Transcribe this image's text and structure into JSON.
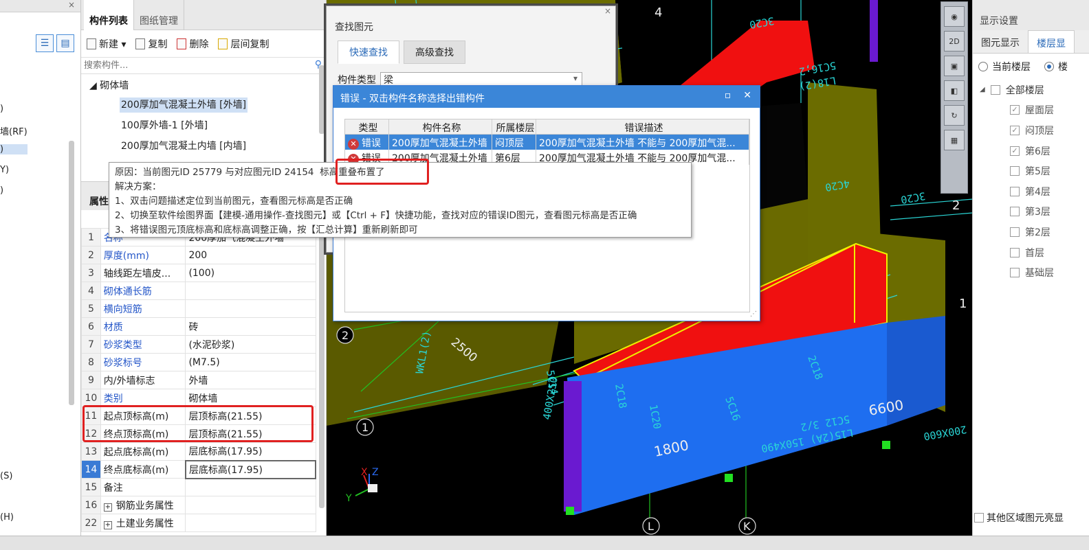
{
  "left_panel": {
    "items": [
      ")",
      "墙(RF)",
      ")",
      "Y)",
      ")",
      "(S)",
      "(H)"
    ]
  },
  "component_panel": {
    "tabs": [
      {
        "label": "构件列表",
        "active": true
      },
      {
        "label": "图纸管理",
        "active": false
      }
    ],
    "toolbar": {
      "new": "新建 ▾",
      "copy": "复制",
      "delete": "删除",
      "floor_copy": "层间复制"
    },
    "search_placeholder": "搜索构件...",
    "tree": {
      "root": "◢ 砌体墙",
      "items": [
        "200厚加气混凝土外墙 [外墙]",
        "100厚外墙-1 [外墙]",
        "200厚加气混凝土内墙 [内墙]"
      ]
    },
    "attr_title": "属性",
    "attributes": [
      {
        "n": "1",
        "key": "名称",
        "value": "200厚加气混凝土外墙",
        "blue": true
      },
      {
        "n": "2",
        "key": "厚度(mm)",
        "value": "200",
        "blue": true
      },
      {
        "n": "3",
        "key": "轴线距左墙皮...",
        "value": "(100)",
        "blue": false
      },
      {
        "n": "4",
        "key": "砌体通长筋",
        "value": "",
        "blue": true
      },
      {
        "n": "5",
        "key": "横向短筋",
        "value": "",
        "blue": true
      },
      {
        "n": "6",
        "key": "材质",
        "value": "砖",
        "blue": true
      },
      {
        "n": "7",
        "key": "砂浆类型",
        "value": "(水泥砂浆)",
        "blue": true
      },
      {
        "n": "8",
        "key": "砂浆标号",
        "value": "(M7.5)",
        "blue": true
      },
      {
        "n": "9",
        "key": "内/外墙标志",
        "value": "外墙",
        "blue": false
      },
      {
        "n": "10",
        "key": "类别",
        "value": "砌体墙",
        "blue": true
      },
      {
        "n": "11",
        "key": "起点顶标高(m)",
        "value": "层顶标高(21.55)",
        "blue": false
      },
      {
        "n": "12",
        "key": "终点顶标高(m)",
        "value": "层顶标高(21.55)",
        "blue": false
      },
      {
        "n": "13",
        "key": "起点底标高(m)",
        "value": "层底标高(17.95)",
        "blue": false
      },
      {
        "n": "14",
        "key": "终点底标高(m)",
        "value": "层底标高(17.95)",
        "blue": false
      },
      {
        "n": "15",
        "key": "备注",
        "value": "",
        "blue": false
      },
      {
        "n": "16",
        "key": "钢筋业务属性",
        "value": "",
        "blue": false
      },
      {
        "n": "22",
        "key": "土建业务属性",
        "value": "",
        "blue": false
      }
    ]
  },
  "find_dialog": {
    "title": "查找图元",
    "close": "×",
    "tabs": [
      {
        "label": "快速查找",
        "active": true
      },
      {
        "label": "高级查找",
        "active": false
      }
    ],
    "type_label": "构件类型",
    "type_value": "梁"
  },
  "error_dialog": {
    "title": "错误 - 双击构件名称选择出错构件",
    "headers": [
      "类型",
      "构件名称",
      "所属楼层",
      "错误描述"
    ],
    "rows": [
      {
        "type": "错误",
        "name": "200厚加气混凝土外墙",
        "floor": "闷顶层",
        "desc": "200厚加气混凝土外墙 不能与 200厚加气混...",
        "selected": true
      },
      {
        "type": "错误",
        "name": "200厚加气混凝土外墙",
        "floor": "第6层",
        "desc": "200厚加气混凝土外墙 不能与 200厚加气混...",
        "selected": false
      }
    ]
  },
  "tooltip": {
    "reason_prefix": "原因：当前图元ID 25779 与对应图元ID 24154",
    "reason_highlight": "标高重叠布置了",
    "solution_title": "解决方案：",
    "steps": [
      "1、双击问题描述定位到当前图元，查看图元标高是否正确",
      "2、切换至软件绘图界面【建模-通用操作-查找图元】或【Ctrl + F】快捷功能，查找对应的错误ID图元，查看图元标高是否正确",
      "3、将错误图元顶底标高和底标高调整正确，按【汇总计算】重新刷新即可"
    ]
  },
  "viewport": {
    "labels": {
      "axis_4": "4",
      "axis_2_right": "2",
      "axis_1_right": "1",
      "axis_2_left": "2",
      "axis_1_left": "1",
      "axis_L": "L",
      "axis_K": "K",
      "dim_1800": "1800",
      "dim_6600": "6600",
      "dim_2500": "2500",
      "axis_x": "X",
      "axis_y": "Y",
      "axis_z": "Z",
      "beam_text_1": "3C20",
      "beam_text_2": "5C16;2",
      "beam_text_3": "L18(2)",
      "beam_text_4": "4C20",
      "beam_text_5": "3C20",
      "beam_text_6": "5C16",
      "beam_text_7": "2C18",
      "beam_text_8": "5C12 3/2",
      "beam_text_9": "L15(2A) 150X490",
      "beam_text_10": "200X600",
      "beam_text_11": "5C14",
      "beam_text_12": "2C18",
      "beam_text_13": "1C20",
      "beam_text_14": "400X250",
      "beam_text_15": "WKL1(2)"
    },
    "colors": {
      "wall_olive": "#6b6c00",
      "beam_red": "#f01010",
      "slab_blue": "#1e6ef0",
      "column_purple": "#6a1ad0",
      "grid_cyan": "#2ad6d6",
      "beam_outline": "#f0f000"
    }
  },
  "view_toolbar": {
    "btn_2d": "2D"
  },
  "display_panel": {
    "title": "显示设置",
    "tabs": [
      {
        "label": "图元显示",
        "active": false
      },
      {
        "label": "楼层显",
        "active": true
      }
    ],
    "radio_current": "当前楼层",
    "radio_all": "楼",
    "all_floors": "全部楼层",
    "floors": [
      {
        "label": "屋面层",
        "checked": true
      },
      {
        "label": "闷顶层",
        "checked": true
      },
      {
        "label": "第6层",
        "checked": true
      },
      {
        "label": "第5层",
        "checked": false
      },
      {
        "label": "第4层",
        "checked": false
      },
      {
        "label": "第3层",
        "checked": false
      },
      {
        "label": "第2层",
        "checked": false
      },
      {
        "label": "首层",
        "checked": false
      },
      {
        "label": "基础层",
        "checked": false
      }
    ],
    "footer": "其他区域图元亮显"
  }
}
